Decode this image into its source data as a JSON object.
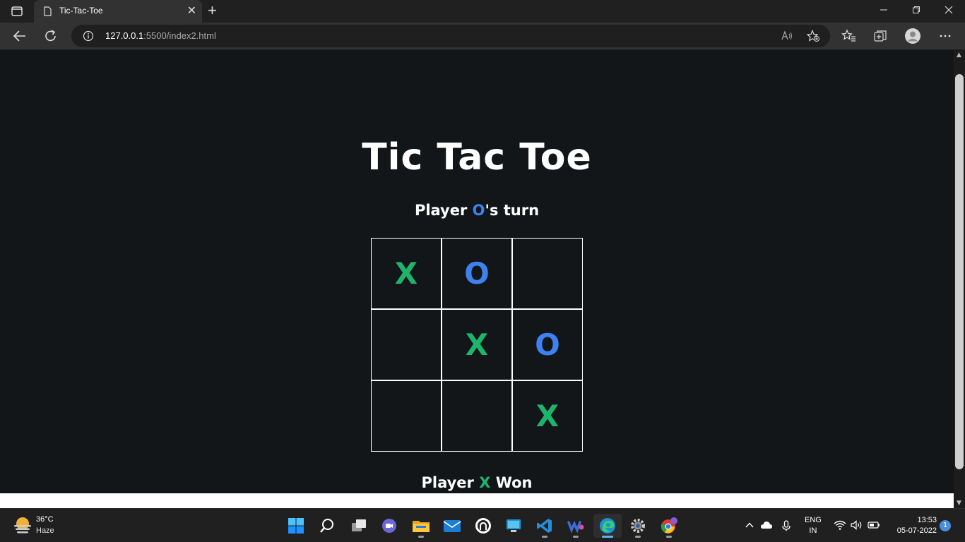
{
  "browser": {
    "tab_title": "Tic-Tac-Toe",
    "url_host": "127.0.0.1",
    "url_path": ":5500/index2.html",
    "new_tab_symbol": "+",
    "close_symbol": "✕"
  },
  "game": {
    "title": "Tic Tac Toe",
    "turn_prefix": "Player ",
    "turn_symbol": "O",
    "turn_suffix": "'s turn",
    "board": [
      "X",
      "O",
      "",
      "",
      "X",
      "O",
      "",
      "",
      "X"
    ],
    "result_prefix": "Player ",
    "result_symbol": "X",
    "result_suffix": " Won",
    "colors": {
      "x": "#1db56c",
      "o": "#3d82f0",
      "background": "#131619",
      "grid": "#ffffff"
    }
  },
  "taskbar": {
    "weather_temp": "36°C",
    "weather_condition": "Haze",
    "apps": [
      "start-icon",
      "search-icon",
      "task-view-icon",
      "teams-chat-icon",
      "file-explorer-icon",
      "mail-icon",
      "github-icon",
      "remote-desktop-icon",
      "vscode-icon",
      "webex-icon",
      "edge-icon",
      "settings-icon",
      "chrome-icon"
    ],
    "language_line1": "ENG",
    "language_line2": "IN",
    "time": "13:53",
    "date": "05-07-2022",
    "notification_count": "1"
  }
}
